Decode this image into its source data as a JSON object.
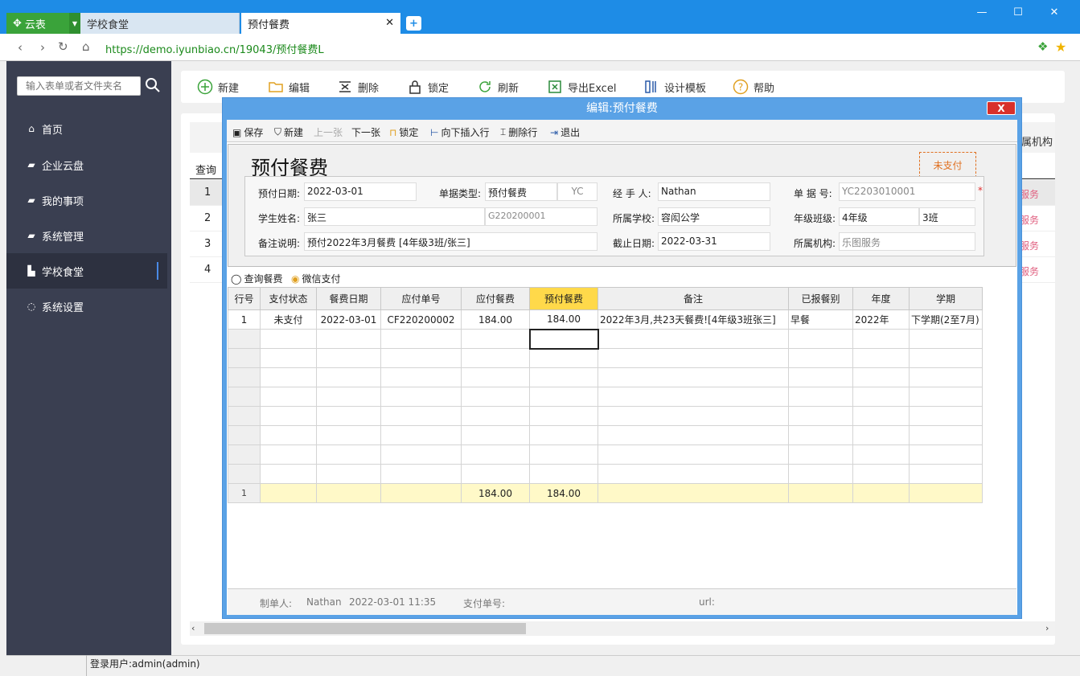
{
  "browser": {
    "brand_tab": "云表",
    "tabs": [
      "学校食堂",
      "预付餐费"
    ],
    "url": "https://demo.iyunbiao.cn/19043/预付餐费L"
  },
  "sidebar": {
    "search_placeholder": "输入表单或者文件夹名",
    "items": [
      "首页",
      "企业云盘",
      "我的事项",
      "系统管理",
      "学校食堂",
      "系统设置"
    ]
  },
  "main_toolbar": [
    "新建",
    "编辑",
    "删除",
    "锁定",
    "刷新",
    "导出Excel",
    "设计模板",
    "帮助"
  ],
  "list": {
    "header_last": "属机构",
    "query_label": "查询",
    "rows": [
      "1",
      "2",
      "3",
      "4"
    ],
    "service_text": "服务"
  },
  "modal": {
    "title": "编辑:预付餐费",
    "close": "X",
    "toolbar": [
      "保存",
      "新建",
      "上一张",
      "下一张",
      "锁定",
      "向下插入行",
      "删除行",
      "退出"
    ],
    "form_title": "预付餐费",
    "stamp": "未支付",
    "fields": {
      "prepay_date_label": "预付日期:",
      "prepay_date": "2022-03-01",
      "doc_type_label": "单据类型:",
      "doc_type": "预付餐费",
      "doc_type_code": "YC",
      "handler_label": "经 手 人:",
      "handler": "Nathan",
      "doc_no_label": "单 据 号:",
      "doc_no": "YC2203010001",
      "student_label": "学生姓名:",
      "student": "张三",
      "student_code": "G220200001",
      "school_label": "所属学校:",
      "school": "容闳公学",
      "grade_label": "年级班级:",
      "grade": "4年级",
      "class": "3班",
      "remark_label": "备注说明:",
      "remark": "预付2022年3月餐费 [4年级3班/张三]",
      "deadline_label": "截止日期:",
      "deadline": "2022-03-31",
      "org_label": "所属机构:",
      "org": "乐图服务"
    },
    "grid_toolbar": [
      "查询餐费",
      "微信支付"
    ],
    "grid": {
      "headers": [
        "行号",
        "支付状态",
        "餐费日期",
        "应付单号",
        "应付餐费",
        "预付餐费",
        "备注",
        "已报餐别",
        "年度",
        "学期"
      ],
      "rows": [
        [
          "1",
          "未支付",
          "2022-03-01",
          "CF220200002",
          "184.00",
          "184.00",
          "2022年3月,共23天餐费![4年级3班张三]",
          "早餐",
          "2022年",
          "下学期(2至7月)"
        ]
      ],
      "summary": [
        "1",
        "",
        "",
        "",
        "184.00",
        "184.00",
        "",
        "",
        "",
        ""
      ]
    },
    "footer": {
      "maker_label": "制单人:",
      "maker": "Nathan",
      "made_time": "2022-03-01 11:35",
      "pay_no_label": "支付单号:",
      "url_label": "url:"
    }
  },
  "status": {
    "user": "登录用户:admin(admin)"
  }
}
